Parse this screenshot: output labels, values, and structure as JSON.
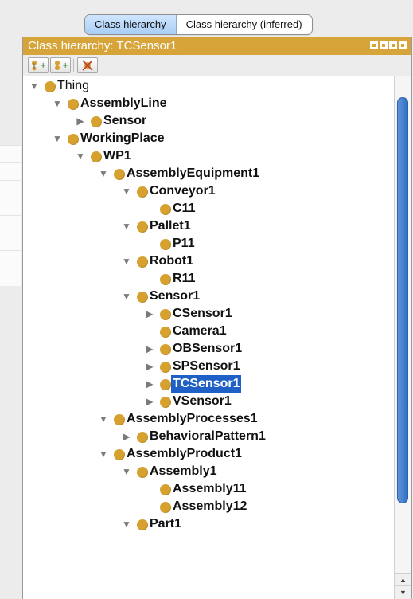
{
  "tabs": [
    {
      "label": "Class hierarchy",
      "active": true
    },
    {
      "label": "Class hierarchy (inferred)",
      "active": false
    }
  ],
  "panel": {
    "title": "Class hierarchy: TCSensor1",
    "accent_color": "#d7a43a",
    "title_buttons": [
      "restore-icon",
      "minimize-icon",
      "maximize-icon",
      "close-icon"
    ]
  },
  "toolbar": {
    "buttons": [
      {
        "name": "add-subclass-icon"
      },
      {
        "name": "add-sibling-class-icon"
      },
      {
        "name": "delete-class-icon"
      }
    ]
  },
  "tree": {
    "selection_color": "#1f60c7",
    "nodes": [
      {
        "label": "Thing",
        "depth": 0,
        "state": "expanded"
      },
      {
        "label": "AssemblyLine",
        "depth": 1,
        "state": "expanded"
      },
      {
        "label": "Sensor",
        "depth": 2,
        "state": "collapsed"
      },
      {
        "label": "WorkingPlace",
        "depth": 1,
        "state": "expanded"
      },
      {
        "label": "WP1",
        "depth": 2,
        "state": "expanded"
      },
      {
        "label": "AssemblyEquipment1",
        "depth": 3,
        "state": "expanded"
      },
      {
        "label": "Conveyor1",
        "depth": 4,
        "state": "expanded"
      },
      {
        "label": "C11",
        "depth": 5,
        "state": "leaf"
      },
      {
        "label": "Pallet1",
        "depth": 4,
        "state": "expanded"
      },
      {
        "label": "P11",
        "depth": 5,
        "state": "leaf"
      },
      {
        "label": "Robot1",
        "depth": 4,
        "state": "expanded"
      },
      {
        "label": "R11",
        "depth": 5,
        "state": "leaf"
      },
      {
        "label": "Sensor1",
        "depth": 4,
        "state": "expanded"
      },
      {
        "label": "CSensor1",
        "depth": 5,
        "state": "collapsed"
      },
      {
        "label": "Camera1",
        "depth": 5,
        "state": "leaf"
      },
      {
        "label": "OBSensor1",
        "depth": 5,
        "state": "collapsed"
      },
      {
        "label": "SPSensor1",
        "depth": 5,
        "state": "collapsed"
      },
      {
        "label": "TCSensor1",
        "depth": 5,
        "state": "collapsed",
        "selected": true
      },
      {
        "label": "VSensor1",
        "depth": 5,
        "state": "collapsed"
      },
      {
        "label": "AssemblyProcesses1",
        "depth": 3,
        "state": "expanded"
      },
      {
        "label": "BehavioralPattern1",
        "depth": 4,
        "state": "collapsed"
      },
      {
        "label": "AssemblyProduct1",
        "depth": 3,
        "state": "expanded"
      },
      {
        "label": "Assembly1",
        "depth": 4,
        "state": "expanded"
      },
      {
        "label": "Assembly11",
        "depth": 5,
        "state": "leaf"
      },
      {
        "label": "Assembly12",
        "depth": 5,
        "state": "leaf"
      },
      {
        "label": "Part1",
        "depth": 4,
        "state": "expanded"
      }
    ]
  },
  "scrollbar": {
    "position": 0.0
  }
}
